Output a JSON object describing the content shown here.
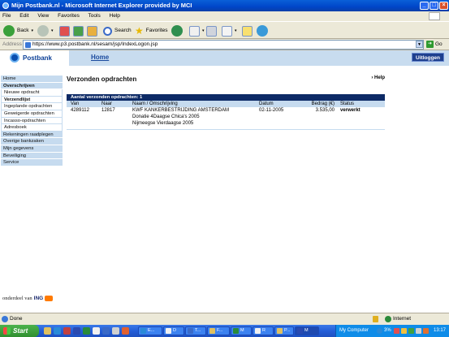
{
  "window": {
    "title": "Mijn Postbank.nl - Microsoft Internet Explorer provided by MCI"
  },
  "menu": [
    "File",
    "Edit",
    "View",
    "Favorites",
    "Tools",
    "Help"
  ],
  "toolbar": {
    "back_label": "Back",
    "search_label": "Search",
    "favorites_label": "Favorites"
  },
  "address": {
    "label": "Address",
    "url": "https://www.p3.postbank.nl/sesam/jsp/IndexLogon.jsp",
    "go_label": "Go"
  },
  "site": {
    "brand": "Postbank",
    "home_link": "Home",
    "logout_button": "Uitloggen",
    "footer": "onderdeel van",
    "footer_brand": "ING"
  },
  "sidebar": {
    "items": [
      {
        "label": "Home"
      },
      {
        "label": "Overschrijven"
      },
      {
        "label": "Nieuwe opdracht"
      },
      {
        "label": "Verzendlijst"
      },
      {
        "label": "Ingeplande opdrachten"
      },
      {
        "label": "Geweigerde opdrachten"
      },
      {
        "label": "Incasso-opdrachten"
      },
      {
        "label": "Adresboek"
      },
      {
        "label": "Rekeningen raadplegen"
      },
      {
        "label": "Overige bankzaken"
      },
      {
        "label": "Mijn gegevens"
      },
      {
        "label": "Beveiliging"
      },
      {
        "label": "Service"
      }
    ]
  },
  "main": {
    "title": "Verzonden opdrachten",
    "help": "Help",
    "count_text": "Aantal verzonden opdrachten: 1",
    "columns": [
      "Van",
      "Naar",
      "Naam / Omschrijving",
      "Datum",
      "Bedrag (€)",
      "Status"
    ],
    "rows": [
      {
        "van": "4289112",
        "naar": "12817",
        "naam": "KWF KANKERBESTRIJDING AMSTERDAM",
        "omschrijving1": "Donatie 4Daagse Chica's 2005",
        "omschrijving2": "Nijmeegse Vierdaagse 2005",
        "datum": "02-11-2005",
        "bedrag": "3.535,00",
        "status": "verwerkt"
      }
    ]
  },
  "statusbar": {
    "text": "Done",
    "zone": "Internet"
  },
  "taskbar": {
    "start": "Start",
    "tasks": [
      "E...",
      "D",
      "T...",
      "F...",
      "M",
      "R",
      "P...",
      "M"
    ],
    "tray": {
      "computer": "My Computer",
      "percent": "3%",
      "clock": "13:17"
    }
  }
}
